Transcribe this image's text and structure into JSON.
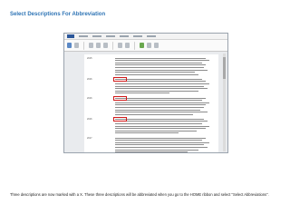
{
  "title": "Select Descriptions For Abbreviation",
  "caption": "Three descriptions are now marked with a X. These three descriptions will be abbreviated when you go to the HOME ribbon and select \"Select Abbreviations\".",
  "document": {
    "entries": [
      {
        "tag": "2015",
        "marked": false,
        "lines": [
          100,
          104,
          96,
          100,
          98,
          102,
          88,
          92
        ]
      },
      {
        "tag": "2016",
        "marked": true,
        "lines": [
          96,
          100,
          104,
          98,
          102,
          92,
          60
        ]
      },
      {
        "tag": "2016",
        "marked": true,
        "lines": [
          100,
          96,
          104,
          100,
          98,
          94,
          102,
          86
        ]
      },
      {
        "tag": "2016",
        "marked": true,
        "lines": [
          98,
          102,
          96,
          104,
          100,
          90,
          70
        ]
      },
      {
        "tag": "2017",
        "marked": false,
        "lines": [
          100,
          96,
          104,
          98,
          102,
          92,
          80
        ]
      }
    ]
  }
}
